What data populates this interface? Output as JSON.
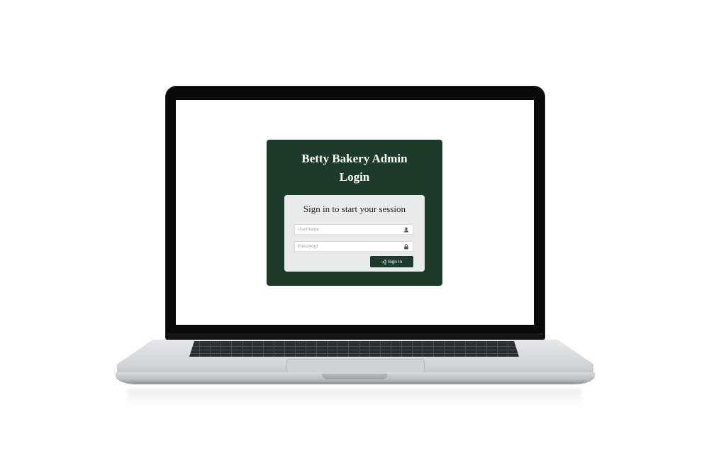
{
  "login": {
    "title_line1": "Betty Bakery Admin",
    "title_line2": "Login",
    "subtitle": "Sign in to start your session",
    "username": {
      "placeholder": "Username",
      "value": "",
      "icon": "user-icon"
    },
    "password": {
      "placeholder": "Password",
      "value": "",
      "icon": "lock-icon"
    },
    "signin_label": "Sign In",
    "signin_icon": "sign-in-icon"
  },
  "colors": {
    "panel_bg": "#1c3b2b",
    "card_bg": "#e9eaea",
    "button_bg": "#1c3b2b",
    "title_text": "#ffffff"
  }
}
